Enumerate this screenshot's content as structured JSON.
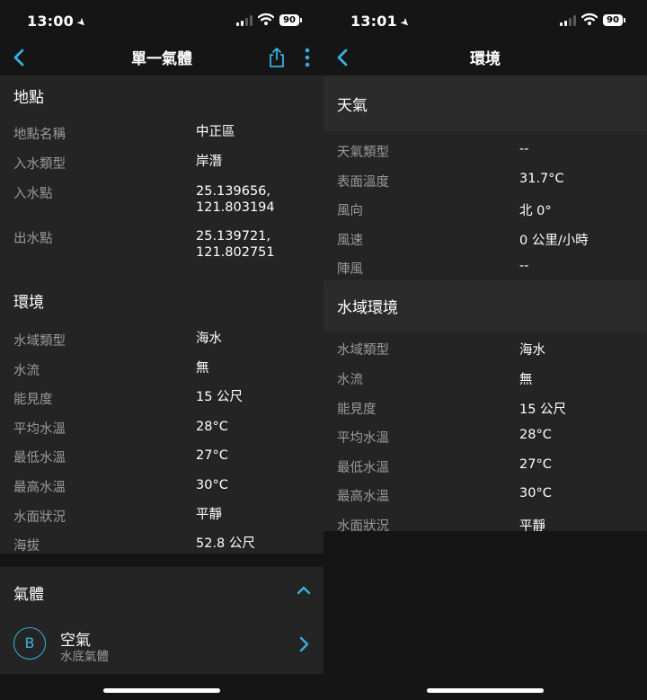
{
  "left": {
    "status": {
      "time": "13:00",
      "battery": "90"
    },
    "nav": {
      "title": "單一氣體"
    },
    "location": {
      "title": "地點",
      "rows": [
        {
          "label": "地點名稱",
          "value": "中正區"
        },
        {
          "label": "入水類型",
          "value": "岸潛"
        },
        {
          "label": "入水點",
          "value": "25.139656,",
          "value2": "121.803194"
        },
        {
          "label": "出水點",
          "value": "25.139721,",
          "value2": "121.802751"
        }
      ]
    },
    "environment": {
      "title": "環境",
      "rows": [
        {
          "label": "水域類型",
          "value": "海水"
        },
        {
          "label": "水流",
          "value": "無"
        },
        {
          "label": "能見度",
          "value": "15 公尺"
        },
        {
          "label": "平均水溫",
          "value": "28°C"
        },
        {
          "label": "最低水溫",
          "value": "27°C"
        },
        {
          "label": "最高水溫",
          "value": "30°C"
        },
        {
          "label": "水面狀況",
          "value": "平靜"
        },
        {
          "label": "海拔",
          "value": "52.8 公尺"
        }
      ]
    },
    "gas": {
      "title": "氣體",
      "badge": "B",
      "name": "空氣",
      "sub": "水底氣體"
    }
  },
  "right": {
    "status": {
      "time": "13:01",
      "battery": "90"
    },
    "nav": {
      "title": "環境"
    },
    "weather": {
      "title": "天氣",
      "rows": [
        {
          "label": "天氣類型",
          "value": "--"
        },
        {
          "label": "表面溫度",
          "value": "31.7°C"
        },
        {
          "label": "風向",
          "value": "北 0°"
        },
        {
          "label": "風速",
          "value": "0 公里/小時"
        },
        {
          "label": "陣風",
          "value": "--"
        }
      ]
    },
    "water": {
      "title": "水域環境",
      "rows": [
        {
          "label": "水域類型",
          "value": "海水"
        },
        {
          "label": "水流",
          "value": "無"
        },
        {
          "label": "能見度",
          "value": "15 公尺"
        },
        {
          "label": "平均水溫",
          "value": "28°C"
        },
        {
          "label": "最低水溫",
          "value": "27°C"
        },
        {
          "label": "最高水溫",
          "value": "30°C"
        },
        {
          "label": "水面狀況",
          "value": "平靜"
        }
      ]
    }
  },
  "colors": {
    "accent": "#3aaee0",
    "background": "#151515",
    "card": "#242424",
    "label": "#9a9a9a"
  }
}
